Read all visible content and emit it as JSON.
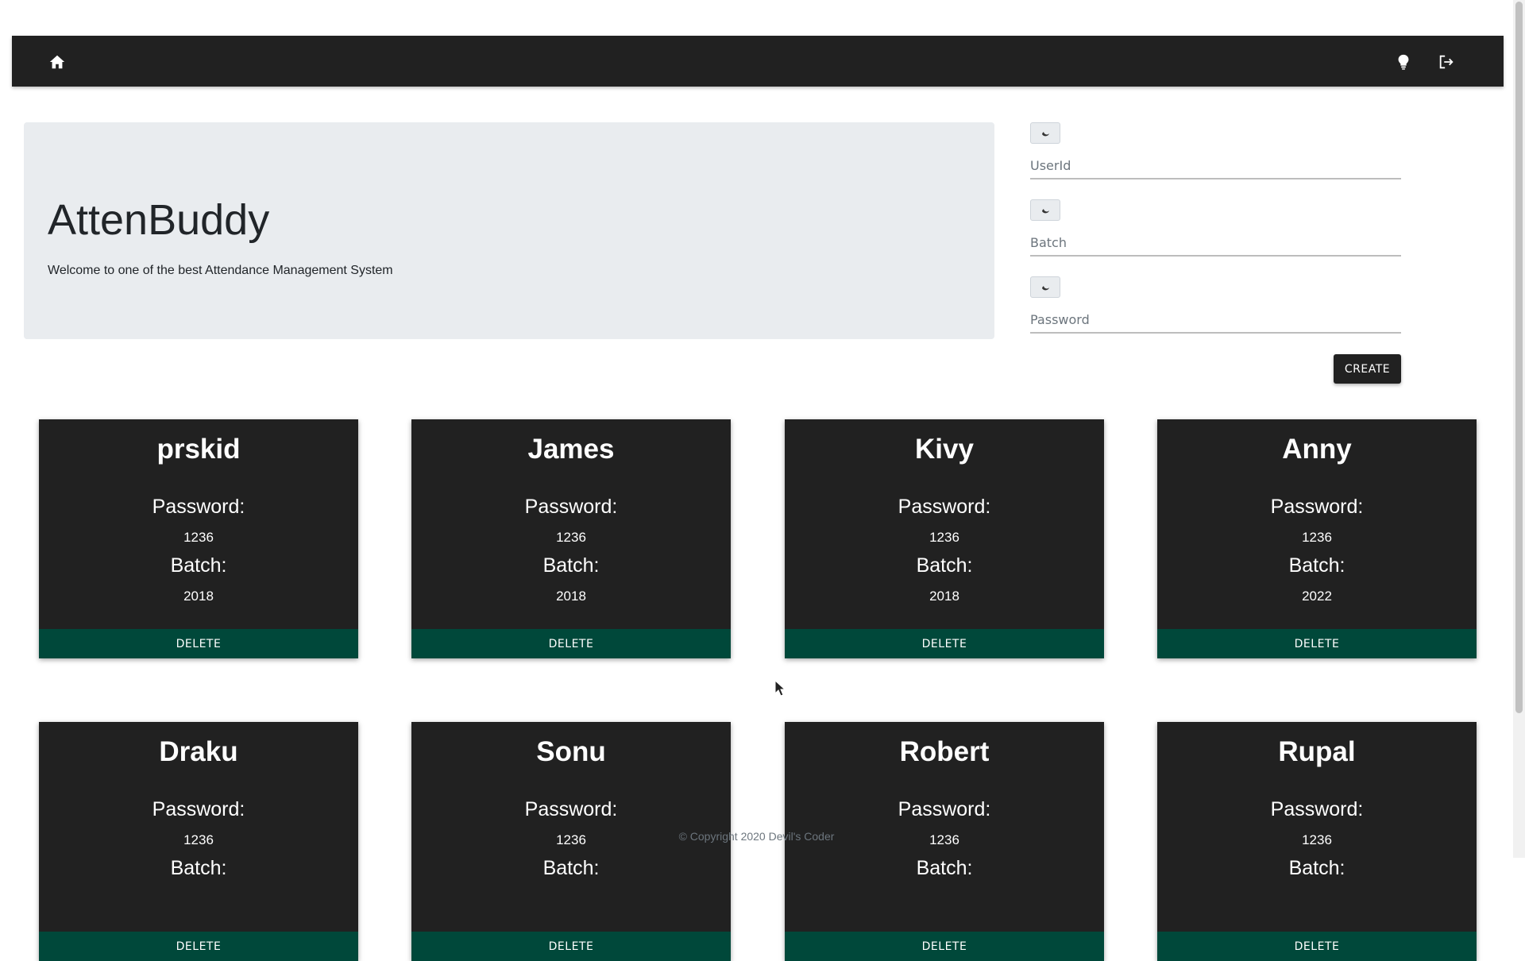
{
  "navbar": {
    "home_icon": "home-icon",
    "theme_icon": "lightbulb-icon",
    "logout_icon": "sign-out-icon"
  },
  "jumbotron": {
    "title": "AttenBuddy",
    "subtitle": "Welcome to one of the best Attendance Management System"
  },
  "form": {
    "fields": [
      {
        "placeholder": "UserId",
        "value": "",
        "icon": "moon-icon"
      },
      {
        "placeholder": "Batch",
        "value": "",
        "icon": "moon-icon"
      },
      {
        "placeholder": "Password",
        "value": "",
        "icon": "moon-icon"
      }
    ],
    "create_label": "CREATE"
  },
  "card_labels": {
    "password": "Password:",
    "batch": "Batch:",
    "delete": "DELETE"
  },
  "users": [
    {
      "name": "prskid",
      "password": "1236",
      "batch": "2018"
    },
    {
      "name": "James",
      "password": "1236",
      "batch": "2018"
    },
    {
      "name": "Kivy",
      "password": "1236",
      "batch": "2018"
    },
    {
      "name": "Anny",
      "password": "1236",
      "batch": "2022"
    },
    {
      "name": "Draku",
      "password": "1236",
      "batch": ""
    },
    {
      "name": "Sonu",
      "password": "1236",
      "batch": ""
    },
    {
      "name": "Robert",
      "password": "1236",
      "batch": ""
    },
    {
      "name": "Rupal",
      "password": "1236",
      "batch": ""
    }
  ],
  "footer": "© Copyright 2020 Devil's Coder",
  "colors": {
    "navbar": "#212121",
    "card": "#212121",
    "delete_button": "#00483a",
    "jumbotron": "#e9ecef"
  }
}
